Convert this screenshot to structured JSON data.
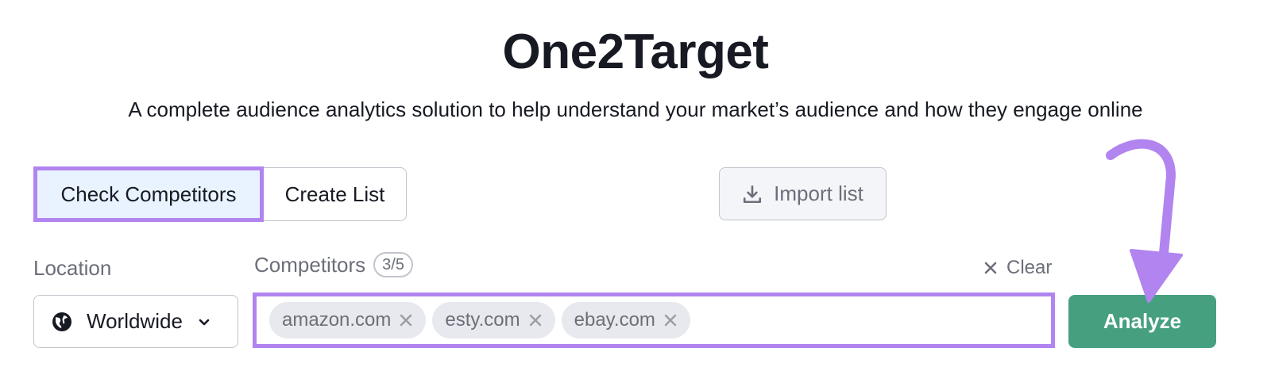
{
  "header": {
    "title": "One2Target",
    "subtitle": "A complete audience analytics solution to help understand your market’s audience and how they engage online"
  },
  "tabs": [
    {
      "label": "Check Competitors",
      "active": true
    },
    {
      "label": "Create List",
      "active": false
    }
  ],
  "import": {
    "label": "Import list",
    "icon": "download-icon"
  },
  "location": {
    "label": "Location",
    "value": "Worldwide",
    "icon": "globe-icon"
  },
  "competitors": {
    "label": "Competitors",
    "count": "3/5",
    "clear_label": "Clear",
    "chips": [
      {
        "label": "amazon.com"
      },
      {
        "label": "esty.com"
      },
      {
        "label": "ebay.com"
      }
    ]
  },
  "analyze": {
    "label": "Analyze"
  },
  "colors": {
    "highlight": "#b184ef",
    "analyze_green": "#46a080",
    "active_tab_bg": "#e9f3ff",
    "text_dark": "#171a22",
    "text_muted": "#6c6e79"
  }
}
